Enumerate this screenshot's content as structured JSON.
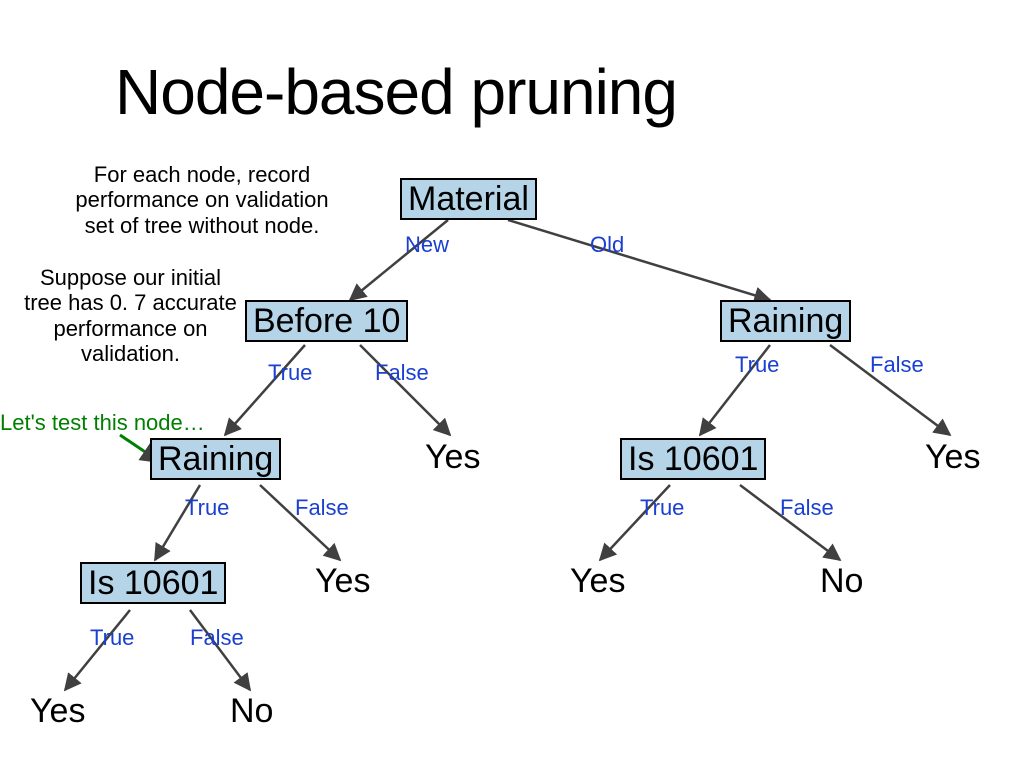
{
  "title": "Node-based pruning",
  "notes": {
    "top_left": "For each node, record\nperformance on validation\nset of tree without node.",
    "mid_left": "Suppose our initial\ntree has 0. 7 accurate\nperformance on\nvalidation.",
    "callout": "Let's test this node…"
  },
  "edge_labels": {
    "new": "New",
    "old": "Old",
    "true": "True",
    "false": "False"
  },
  "nodes": {
    "material": "Material",
    "before10": "Before 10",
    "raining_right": "Raining",
    "raining_left": "Raining",
    "is10601_right": "Is 10601",
    "is10601_left": "Is 10601"
  },
  "leaves": {
    "yes": "Yes",
    "no": "No"
  },
  "colors": {
    "node_fill": "#b5d4e8",
    "edge_stroke": "#404040",
    "edge_label": "#1a3fd1",
    "callout": "#008000"
  }
}
